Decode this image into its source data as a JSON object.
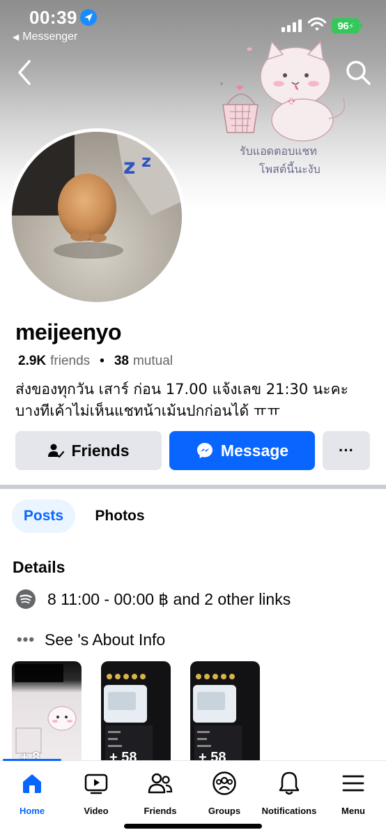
{
  "status_bar": {
    "time": "00:39",
    "back_app": "Messenger",
    "battery": "96"
  },
  "cover": {
    "handwriting_line1": "รับแอดตอบแชท",
    "handwriting_line2": "โพสต์นี้นะงับ"
  },
  "profile": {
    "name": "meijeenyo",
    "friends_count": "2.9K",
    "friends_label": "friends",
    "mutual_count": "38",
    "mutual_label": "mutual",
    "bio_line1": "ส่งของทุกวัน เสาร์ ก่อน 17.00 แจ้งเลข 21:30 นะคะ",
    "bio_line2": "บางทีเค้าไม่เห็นแชทน้าเม้นปกก่อนได้ ㅠㅠ"
  },
  "actions": {
    "friends_label": "Friends",
    "message_label": "Message",
    "more_label": "···"
  },
  "tabs": [
    {
      "label": "Posts",
      "active": true
    },
    {
      "label": "Photos",
      "active": false
    }
  ],
  "details": {
    "title": "Details",
    "links_text": "8 11:00 -  00:00 ฿ and 2 other links",
    "about_text": "See 's About Info"
  },
  "thumbnails": [
    {
      "count": "+ 8"
    },
    {
      "count": "+ 58"
    },
    {
      "count": "+ 58"
    }
  ],
  "bottom_nav": [
    {
      "label": "Home",
      "icon": "home-icon",
      "active": true
    },
    {
      "label": "Video",
      "icon": "video-icon",
      "active": false
    },
    {
      "label": "Friends",
      "icon": "friends-icon",
      "active": false
    },
    {
      "label": "Groups",
      "icon": "groups-icon",
      "active": false
    },
    {
      "label": "Notifications",
      "icon": "bell-icon",
      "active": false
    },
    {
      "label": "Menu",
      "icon": "menu-icon",
      "active": false
    }
  ],
  "colors": {
    "accent": "#0866ff",
    "button_gray": "#e4e6eb",
    "battery_green": "#34c759"
  }
}
